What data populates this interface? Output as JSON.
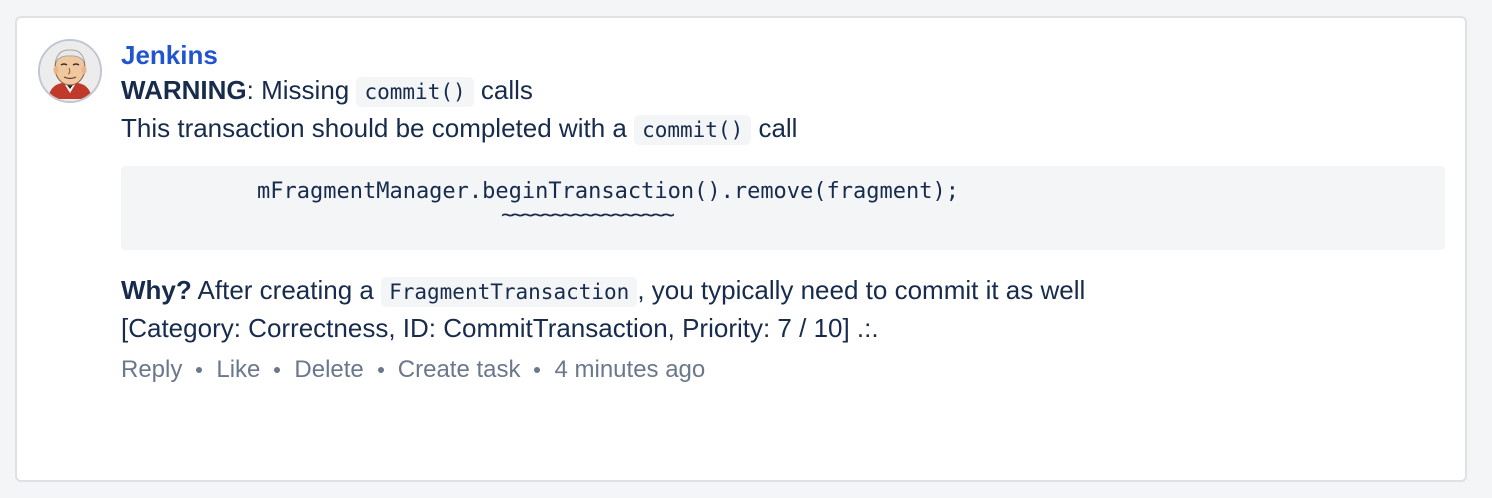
{
  "comment": {
    "author": "Jenkins",
    "avatar_icon": "jenkins-butler-icon",
    "warning": {
      "label": "WARNING",
      "text_before": ": Missing ",
      "code": "commit()",
      "text_after": " calls"
    },
    "description": {
      "text_before": "This transaction should be completed with a ",
      "code": "commit()",
      "text_after": " call"
    },
    "code_snippet": {
      "line": "mFragmentManager.beginTransaction().remove(fragment);",
      "underline": "~~~~~~~~~~~~~~~~~"
    },
    "why": {
      "label": "Why?",
      "text_before": " After creating a ",
      "code": "FragmentTransaction",
      "text_after": ", you typically need to commit it as well"
    },
    "meta": "[Category: Correctness, ID: CommitTransaction, Priority: 7 / 10] .:.",
    "actions": {
      "reply": "Reply",
      "like": "Like",
      "delete": "Delete",
      "create_task": "Create task",
      "timestamp": "4 minutes ago"
    }
  },
  "colors": {
    "author_link": "#2155d0",
    "text": "#172b4d",
    "muted": "#6b778c",
    "code_bg": "#f4f5f7",
    "border": "#dfe1e6"
  }
}
